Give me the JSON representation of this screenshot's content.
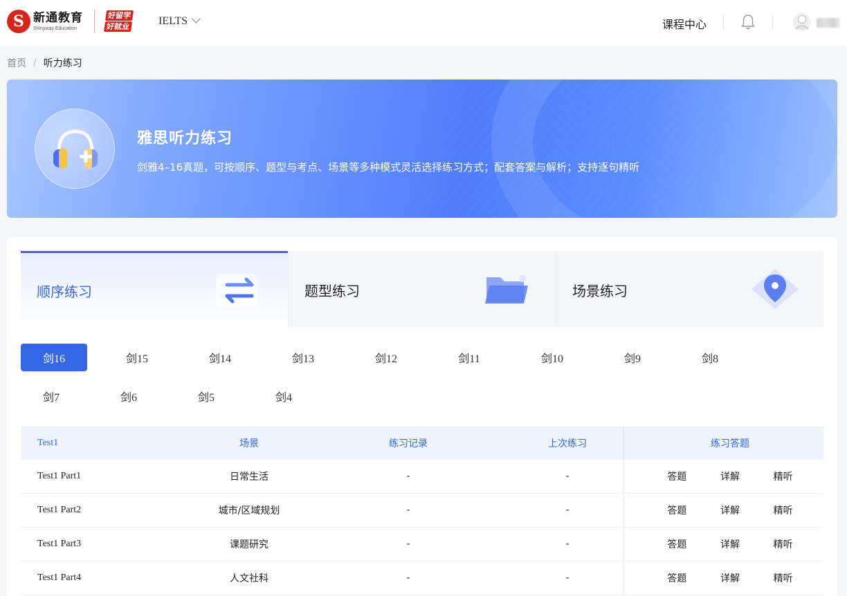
{
  "header": {
    "logo_cn": "新通教育",
    "logo_en": "Shinyway Education",
    "sub_logo_line1": "好留学",
    "sub_logo_line2": "好就业",
    "exam_selector": "IELTS",
    "course_center": "课程中心"
  },
  "breadcrumb": {
    "home": "首页",
    "separator": "/",
    "current": "听力练习"
  },
  "banner": {
    "title": "雅思听力练习",
    "description": "剑雅4–16真题，可按顺序、题型与考点、场景等多种模式灵活选择练习方式；配套答案与解析；支持逐句精听"
  },
  "mode_tabs": [
    {
      "label": "顺序练习",
      "active": true
    },
    {
      "label": "题型练习",
      "active": false
    },
    {
      "label": "场景练习",
      "active": false
    }
  ],
  "books_row1": [
    "剑16",
    "剑15",
    "剑14",
    "剑13",
    "剑12",
    "剑11",
    "剑10",
    "剑9",
    "剑8"
  ],
  "books_row2": [
    "剑7",
    "剑6",
    "剑5",
    "剑4"
  ],
  "active_book": "剑16",
  "table": {
    "headers": [
      "Test1",
      "场景",
      "练习记录",
      "上次练习",
      "练习答题"
    ],
    "rows": [
      {
        "name": "Test1 Part1",
        "scene": "日常生活",
        "record": "-",
        "last": "-",
        "actions": [
          "答题",
          "详解",
          "精听"
        ]
      },
      {
        "name": "Test1 Part2",
        "scene": "城市/区域规划",
        "record": "-",
        "last": "-",
        "actions": [
          "答题",
          "详解",
          "精听"
        ]
      },
      {
        "name": "Test1 Part3",
        "scene": "课题研究",
        "record": "-",
        "last": "-",
        "actions": [
          "答题",
          "详解",
          "精听"
        ]
      },
      {
        "name": "Test1 Part4",
        "scene": "人文社科",
        "record": "-",
        "last": "-",
        "actions": [
          "答题",
          "详解",
          "精听"
        ]
      }
    ]
  },
  "colors": {
    "brand_red": "#d9241c",
    "accent_blue": "#3367e6",
    "table_header_bg": "#f0f4fe"
  },
  "icons": {
    "bell": "bell-icon",
    "avatar": "user-avatar-icon",
    "banner": "headphones-icon",
    "mode_sequence": "swap-arrows-icon",
    "mode_type": "folder-icon",
    "mode_scene": "location-pin-icon"
  }
}
